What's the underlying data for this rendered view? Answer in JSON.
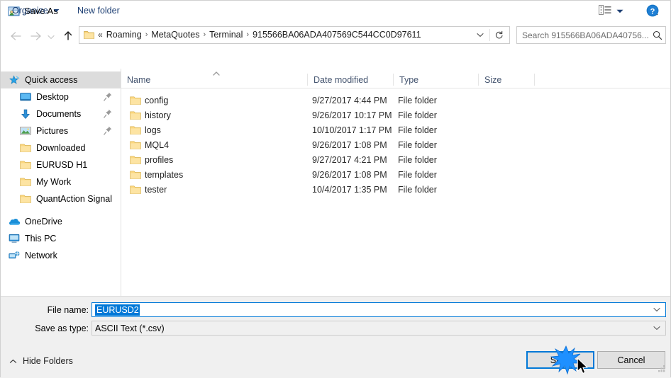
{
  "window": {
    "title": "Save As",
    "icon": "save-as-icon",
    "close_label": "✕"
  },
  "nav": {
    "back_icon": "arrow-left-icon",
    "forward_icon": "arrow-right-icon",
    "recent_icon": "chevron-down-icon",
    "up_icon": "arrow-up-icon",
    "breadcrumb_prefix": "«",
    "breadcrumbs": [
      "Roaming",
      "MetaQuotes",
      "Terminal",
      "915566BA06ADA407569C544CC0D97611"
    ],
    "separator": "›",
    "dropdown_icon": "chevron-down-icon",
    "refresh_icon": "refresh-icon"
  },
  "search": {
    "placeholder": "Search 915566BA06ADA40756...",
    "icon": "search-icon"
  },
  "toolbar": {
    "organize_label": "Organize",
    "new_folder_label": "New folder",
    "view_icon": "view-list-icon",
    "view_caret_icon": "chevron-down-icon",
    "help_icon": "help-icon"
  },
  "sidebar": {
    "items": [
      {
        "label": "Quick access",
        "icon": "star-pin-icon",
        "selected": true,
        "indent": false,
        "pinned": false
      },
      {
        "label": "Desktop",
        "icon": "desktop-icon",
        "selected": false,
        "indent": true,
        "pinned": true
      },
      {
        "label": "Documents",
        "icon": "documents-icon",
        "selected": false,
        "indent": true,
        "pinned": true
      },
      {
        "label": "Pictures",
        "icon": "pictures-icon",
        "selected": false,
        "indent": true,
        "pinned": true
      },
      {
        "label": "Downloaded",
        "icon": "folder-icon",
        "selected": false,
        "indent": true,
        "pinned": false
      },
      {
        "label": "EURUSD H1",
        "icon": "folder-icon",
        "selected": false,
        "indent": true,
        "pinned": false
      },
      {
        "label": "My Work",
        "icon": "folder-icon",
        "selected": false,
        "indent": true,
        "pinned": false
      },
      {
        "label": "QuantAction Signal",
        "icon": "folder-icon",
        "selected": false,
        "indent": true,
        "pinned": false
      },
      {
        "label": "OneDrive",
        "icon": "onedrive-icon",
        "selected": false,
        "indent": false,
        "pinned": false
      },
      {
        "label": "This PC",
        "icon": "this-pc-icon",
        "selected": false,
        "indent": false,
        "pinned": false
      },
      {
        "label": "Network",
        "icon": "network-icon",
        "selected": false,
        "indent": false,
        "pinned": false
      }
    ]
  },
  "filelist": {
    "columns": [
      "Name",
      "Date modified",
      "Type",
      "Size"
    ],
    "sort_column": "Name",
    "sort_direction": "ascending",
    "rows": [
      {
        "name": "config",
        "date": "9/27/2017 4:44 PM",
        "type": "File folder",
        "size": ""
      },
      {
        "name": "history",
        "date": "9/26/2017 10:17 PM",
        "type": "File folder",
        "size": ""
      },
      {
        "name": "logs",
        "date": "10/10/2017 1:17 PM",
        "type": "File folder",
        "size": ""
      },
      {
        "name": "MQL4",
        "date": "9/26/2017 1:08 PM",
        "type": "File folder",
        "size": ""
      },
      {
        "name": "profiles",
        "date": "9/27/2017 4:21 PM",
        "type": "File folder",
        "size": ""
      },
      {
        "name": "templates",
        "date": "9/26/2017 1:08 PM",
        "type": "File folder",
        "size": ""
      },
      {
        "name": "tester",
        "date": "10/4/2017 1:35 PM",
        "type": "File folder",
        "size": ""
      }
    ]
  },
  "form": {
    "filename_label": "File name:",
    "filename_value": "EURUSD2",
    "filename_selected": true,
    "savetype_label": "Save as type:",
    "savetype_value": "ASCII Text (*.csv)",
    "dropdown_icon": "chevron-down-icon"
  },
  "footer": {
    "hide_folders_label": "Hide Folders",
    "hide_folders_icon": "chevron-up-icon",
    "save_label": "Save",
    "cancel_label": "Cancel",
    "resize_grip_icon": "resize-grip-icon"
  },
  "colors": {
    "accent": "#0078d7",
    "selection": "#0078d7",
    "folder": "#fcd77f",
    "sidebar_selected": "#dcdcdc",
    "dialog_bg": "#f0f0f0",
    "header_text": "#44546f",
    "link": "#1d3f73"
  }
}
